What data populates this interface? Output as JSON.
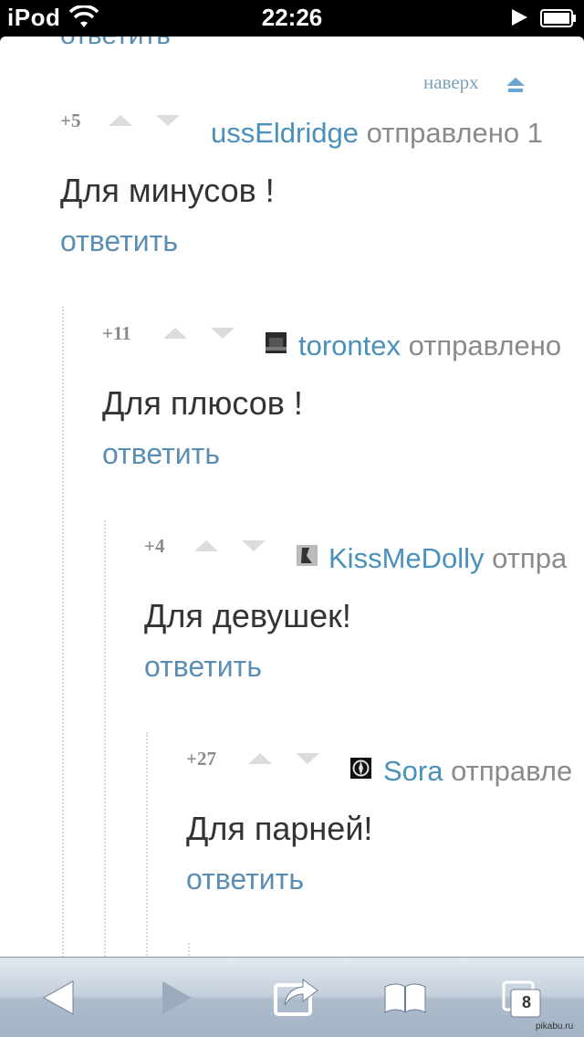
{
  "status_bar": {
    "carrier": "iPod",
    "time": "22:26"
  },
  "page": {
    "top_link": "наверх"
  },
  "comments": [
    {
      "score": "+5",
      "author": "ussEldridge",
      "meta": "отправлено 1",
      "text": "Для минусов !",
      "reply": "ответить",
      "has_avatar": false
    },
    {
      "score": "+11",
      "author": "torontex",
      "meta": "отправлено",
      "text": "Для плюсов !",
      "reply": "ответить",
      "has_avatar": true
    },
    {
      "score": "+4",
      "author": "KissMeDolly",
      "meta": "отпра",
      "text": "Для девушек!",
      "reply": "ответить",
      "has_avatar": true
    },
    {
      "score": "+27",
      "author": "Sora",
      "meta": "отправле",
      "text": "Для парней!",
      "reply": "ответить",
      "has_avatar": true
    }
  ],
  "toolbar": {
    "tab_count": "8",
    "back_icon": "back-arrow-icon",
    "forward_icon": "forward-arrow-icon",
    "share_icon": "share-icon",
    "bookmarks_icon": "book-icon",
    "tabs_icon": "tabs-icon"
  },
  "watermark": "pikabu.ru",
  "colors": {
    "link": "#4a90bd",
    "reply": "#5b8eb4",
    "meta": "#8a8a8a",
    "text": "#333333"
  }
}
